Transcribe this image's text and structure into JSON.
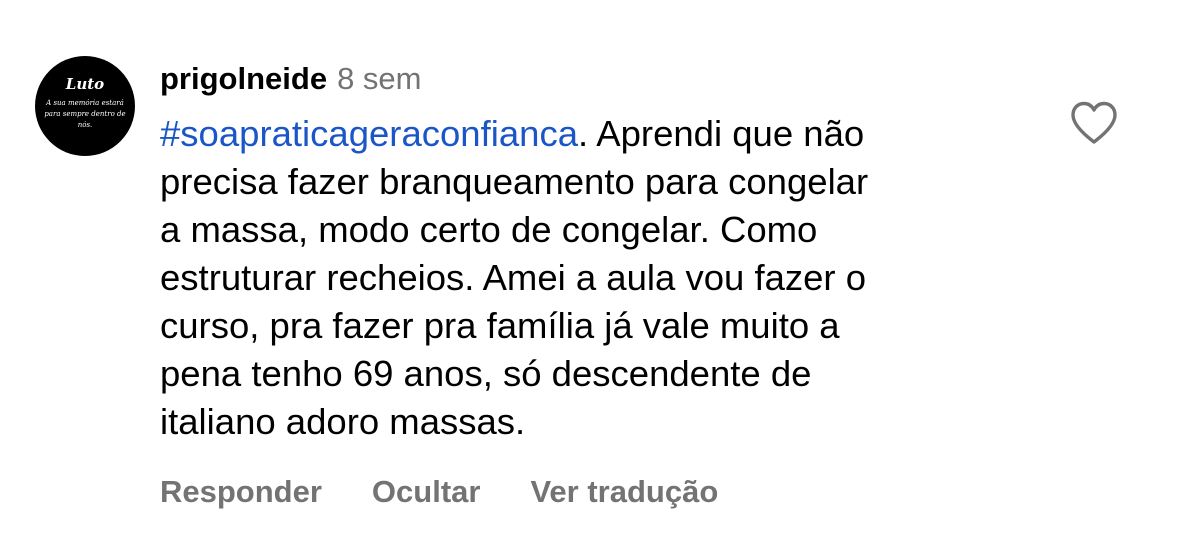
{
  "comment": {
    "avatar": {
      "title": "Luto",
      "caption": "A sua memória estará para sempre dentro de nós."
    },
    "username": "prigolneide",
    "timestamp": "8 sem",
    "hashtag": "#soapraticageraconfianca",
    "text": ". Aprendi que não\nprecisa fazer branqueamento para congelar\na massa, modo certo de congelar. Como\nestruturar recheios. Amei a aula vou fazer o\ncurso, pra fazer pra família já vale muito a\npena tenho 69 anos, só descendente de\nitaliano adoro massas."
  },
  "actions": {
    "reply_label": "Responder",
    "hide_label": "Ocultar",
    "translate_label": "Ver tradução"
  },
  "icons": {
    "like": "heart-icon"
  },
  "colors": {
    "hashtag": "#1a56c6",
    "secondary_text": "#737373",
    "primary_text": "#000000"
  }
}
